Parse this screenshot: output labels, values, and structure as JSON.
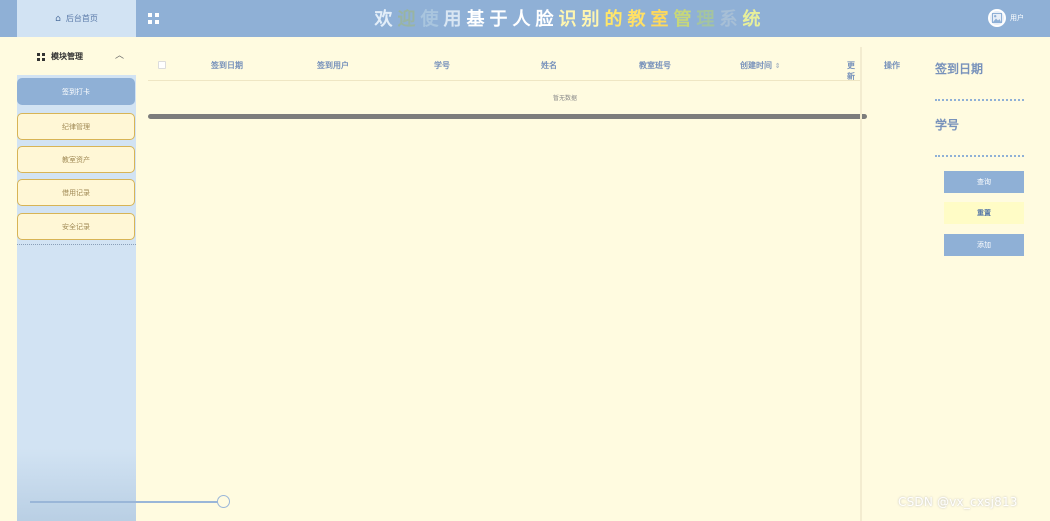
{
  "header": {
    "home_label": "后台首页",
    "title_chars": [
      {
        "ch": "欢",
        "color": "#e3eef9"
      },
      {
        "ch": "迎",
        "color": "#99b4a2"
      },
      {
        "ch": "使",
        "color": "#a9c5de"
      },
      {
        "ch": "用",
        "color": "#d9e6f3"
      },
      {
        "ch": "基",
        "color": "#ffffff"
      },
      {
        "ch": "于",
        "color": "#ffffff"
      },
      {
        "ch": "人",
        "color": "#ffffff"
      },
      {
        "ch": "脸",
        "color": "#ffffff"
      },
      {
        "ch": "识",
        "color": "#fff6b0"
      },
      {
        "ch": "别",
        "color": "#fff6b0"
      },
      {
        "ch": "的",
        "color": "#ffe66a"
      },
      {
        "ch": "教",
        "color": "#ffe066"
      },
      {
        "ch": "室",
        "color": "#ffd95a"
      },
      {
        "ch": "管",
        "color": "#c6d77a"
      },
      {
        "ch": "理",
        "color": "#a4c4a0"
      },
      {
        "ch": "系",
        "color": "#a7bfd6"
      },
      {
        "ch": "统",
        "color": "#e7ef9a"
      }
    ],
    "user_label": "用户",
    "colors": {
      "bar": "#8fb0d6",
      "home_bg": "#d2e3f3"
    }
  },
  "sidebar": {
    "group_label": "模块管理",
    "group_icon": "grid-icon",
    "chevron_icon": "chevron-up-icon",
    "items": [
      {
        "label": "签到打卡",
        "active": true
      },
      {
        "label": "纪律管理",
        "active": false
      },
      {
        "label": "教室资产",
        "active": false
      },
      {
        "label": "借用记录",
        "active": false
      },
      {
        "label": "安全记录",
        "active": false
      }
    ]
  },
  "table": {
    "columns": [
      "签到日期",
      "签到用户",
      "学号",
      "姓名",
      "教室班号",
      "创建时间",
      "更新"
    ],
    "sort_glyph": "⇕",
    "ops_label": "操作",
    "empty_text": "暂无数据"
  },
  "search": {
    "fields": [
      "签到日期",
      "学号"
    ],
    "query_label": "查询",
    "reset_label": "重置",
    "add_label": "添加"
  },
  "watermark": "CSDN @vx_cxsj813",
  "colors": {
    "page_bg": "#fffbe0",
    "accent": "#8fb0d6",
    "header_text": "#7892bb",
    "menu_border": "#d8b455"
  }
}
